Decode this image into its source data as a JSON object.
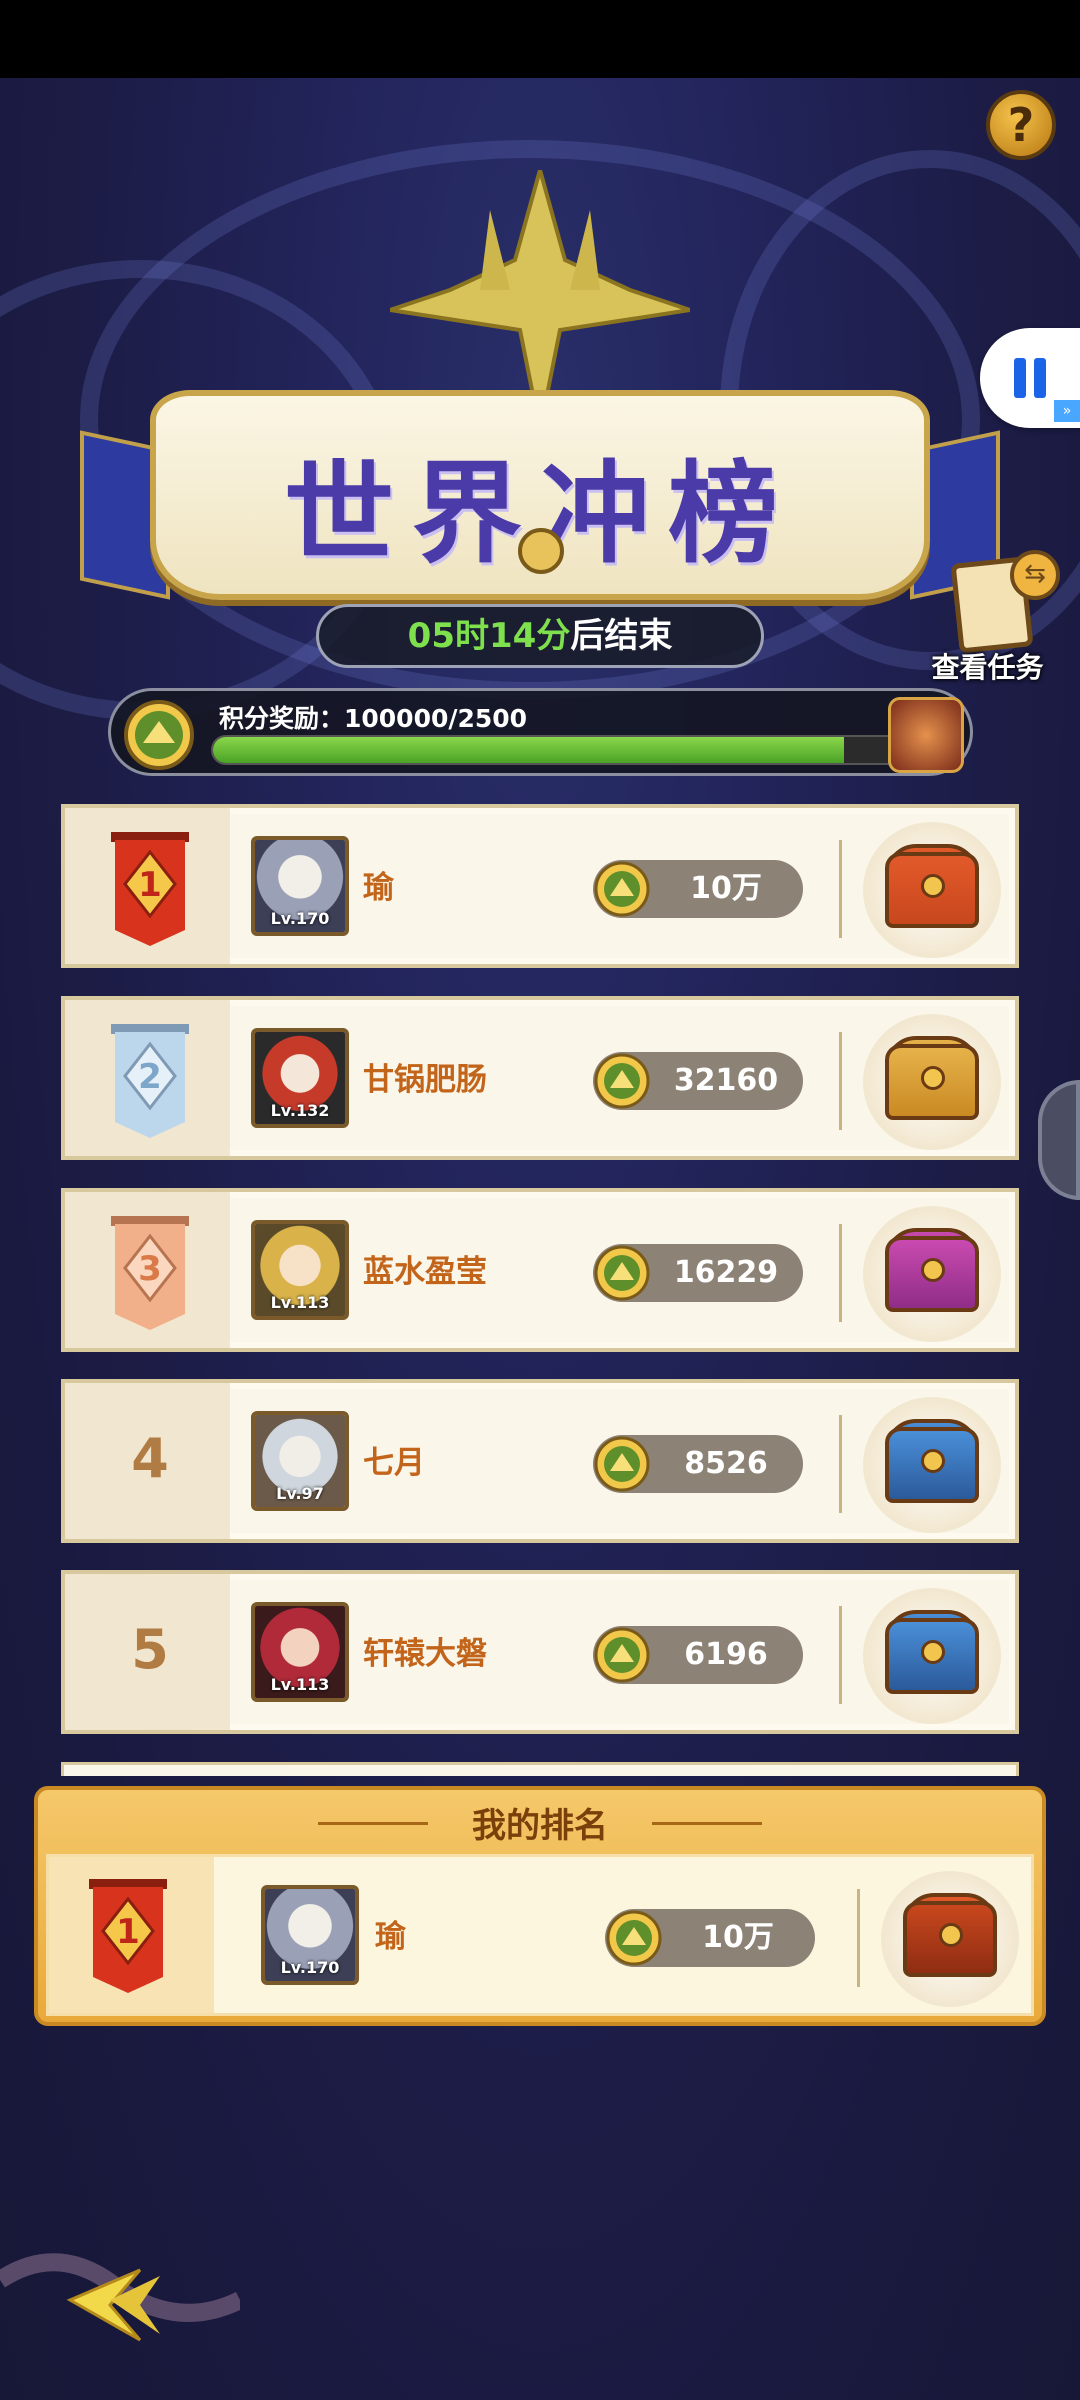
{
  "banner": {
    "title": "世界冲榜"
  },
  "timer": {
    "hours": "05",
    "hours_unit": "时",
    "minutes": "14",
    "minutes_unit": "分",
    "suffix": "后结束"
  },
  "task_button": {
    "label": "查看任务"
  },
  "points_reward": {
    "label": "积分奖励：100000/2500",
    "progress_fraction": 0.92
  },
  "ranking": [
    {
      "rank": "1",
      "name": "瑜",
      "level": "Lv.170",
      "score": "10万",
      "chest": "red-gold-chest-icon"
    },
    {
      "rank": "2",
      "name": "甘锅肥肠",
      "level": "Lv.132",
      "score": "32160",
      "chest": "gold-chest-icon"
    },
    {
      "rank": "3",
      "name": "蓝水盈莹",
      "level": "Lv.113",
      "score": "16229",
      "chest": "purple-chest-icon"
    },
    {
      "rank": "4",
      "name": "七月",
      "level": "Lv.97",
      "score": "8526",
      "chest": "blue-chest-icon"
    },
    {
      "rank": "5",
      "name": "轩辕大磐",
      "level": "Lv.113",
      "score": "6196",
      "chest": "blue-chest-icon"
    }
  ],
  "my_rank": {
    "title": "我的排名",
    "rank": "1",
    "name": "瑜",
    "level": "Lv.170",
    "score": "10万"
  },
  "colors": {
    "gold": "#e9a93a",
    "name": "#c2651b",
    "timer_green": "#7ee04c",
    "accent_blue": "#4b3ba8"
  }
}
